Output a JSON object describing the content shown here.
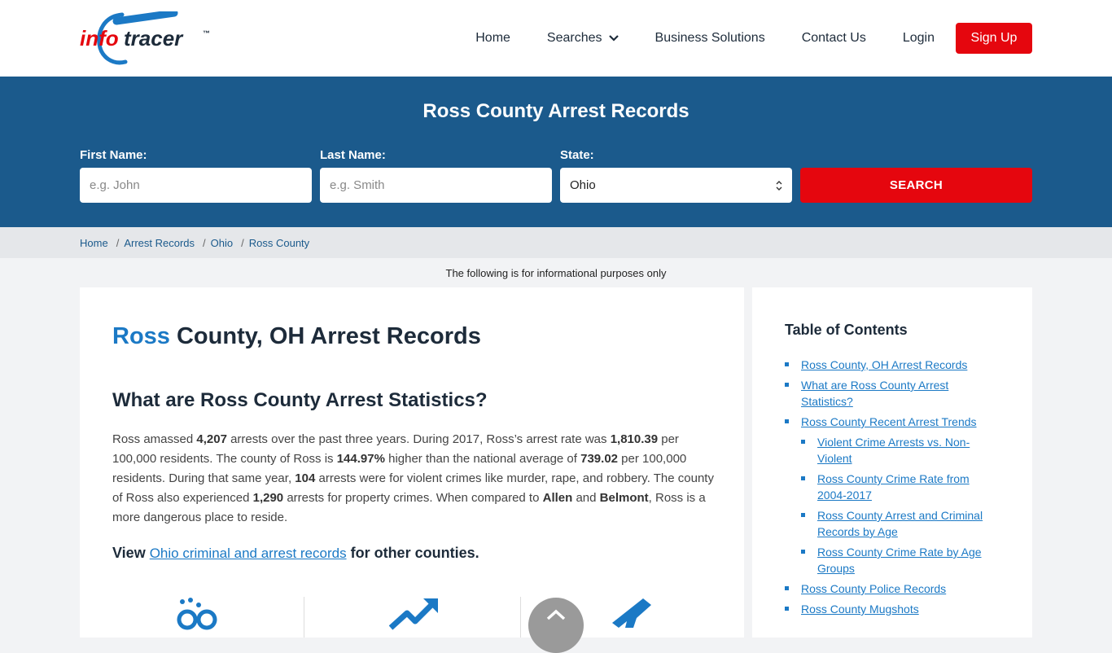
{
  "brand": {
    "logo_info": "info",
    "logo_tracer": "tracer",
    "logo_tm": "™"
  },
  "nav": {
    "home": "Home",
    "searches": "Searches",
    "business": "Business Solutions",
    "contact": "Contact Us",
    "login": "Login",
    "signup": "Sign Up"
  },
  "search": {
    "title": "Ross County Arrest Records",
    "first_label": "First Name:",
    "first_placeholder": "e.g. John",
    "last_label": "Last Name:",
    "last_placeholder": "e.g. Smith",
    "state_label": "State:",
    "state_value": "Ohio",
    "button": "SEARCH"
  },
  "breadcrumb": [
    "Home",
    "Arrest Records",
    "Ohio",
    "Ross County"
  ],
  "info_note": "The following is for informational purposes only",
  "main": {
    "h1_accent": "Ross",
    "h1_rest": " County, OH Arrest Records",
    "h2": "What are Ross County Arrest Statistics?",
    "p": {
      "t1": "Ross amassed ",
      "b1": "4,207",
      "t2": " arrests over the past three years. During 2017, Ross’s arrest rate was ",
      "b2": "1,810.39",
      "t3": " per 100,000 residents. The county of Ross is ",
      "b3": "144.97%",
      "t4": " higher than the national average of ",
      "b4": "739.02",
      "t5": " per 100,000 residents. During that same year, ",
      "b5": "104",
      "t6": " arrests were for violent crimes like murder, rape, and robbery. The county of Ross also experienced ",
      "b6": "1,290",
      "t7": " arrests for property crimes. When compared to ",
      "b7": "Allen",
      "t8": " and ",
      "b8": "Belmont",
      "t9": ", Ross is a more dangerous place to reside."
    },
    "view_prefix": "View ",
    "view_link": "Ohio criminal and arrest records",
    "view_suffix": " for other counties."
  },
  "toc": {
    "title": "Table of Contents",
    "items": [
      {
        "label": "Ross County, OH Arrest Records",
        "level": 1
      },
      {
        "label": "What are Ross County Arrest Statistics?",
        "level": 1
      },
      {
        "label": "Ross County Recent Arrest Trends",
        "level": 1
      },
      {
        "label": "Violent Crime Arrests vs. Non-Violent",
        "level": 2
      },
      {
        "label": "Ross County Crime Rate from 2004-2017",
        "level": 2
      },
      {
        "label": "Ross County Arrest and Criminal Records by Age",
        "level": 2
      },
      {
        "label": "Ross County Crime Rate by Age Groups",
        "level": 2
      },
      {
        "label": "Ross County Police Records",
        "level": 1
      },
      {
        "label": "Ross County Mugshots",
        "level": 1
      }
    ]
  },
  "colors": {
    "brand_blue": "#1b5a8c",
    "accent_blue": "#1b79c5",
    "red": "#e5060e"
  }
}
